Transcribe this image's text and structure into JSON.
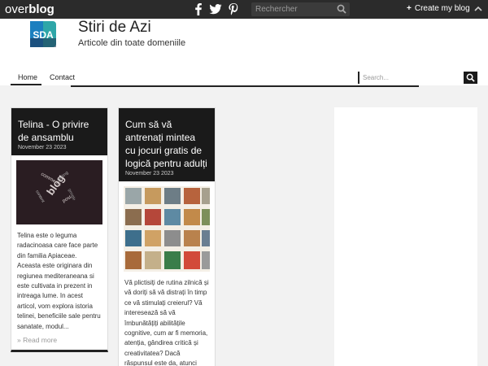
{
  "topbar": {
    "brand_part1": "over",
    "brand_part2": "blog",
    "search_placeholder": "Rechercher",
    "create_label": "Create my blog",
    "social_icons": [
      "facebook-icon",
      "twitter-icon",
      "pinterest-icon"
    ]
  },
  "header": {
    "logo_text": "SDA",
    "title": "Stiri de Azi",
    "subtitle": "Articole din toate domeniile"
  },
  "nav": {
    "items": [
      "Home",
      "Contact"
    ]
  },
  "blog_search": {
    "placeholder": "Search..."
  },
  "posts": [
    {
      "title": "Telina - O privire de ansamblu",
      "date": "November 23 2023",
      "excerpt": "Telina este o leguma radacinoasa care face parte din familia Apiaceae. Aceasta este originara din regiunea mediteraneana si este cultivata in prezent in intreaga lume. In acest articol, vom explora istoria telinei, beneficiile sale pentru sanatate, modul...",
      "read_more": "Read more",
      "image_words": [
        "blog",
        "comments",
        "writing",
        "content",
        "post",
        "google"
      ]
    },
    {
      "title": "Cum să vă antrenați mintea cu jocuri gratis de logică pentru adulți",
      "date": "November 23 2023",
      "excerpt": "Vă plictisiți de rutina zilnică și vă doriți să vă distrați în timp ce vă stimulați creierul? Vă interesează să vă îmbunătățiți abilitățile cognitive, cum ar fi memoria, atenția, gândirea critică și creativitatea? Dacă răspunsul este da, atunci"
    }
  ],
  "colors": {
    "topbar": "#2b2b2b",
    "accent": "#e8b000",
    "card_head": "#1a1a1a"
  }
}
